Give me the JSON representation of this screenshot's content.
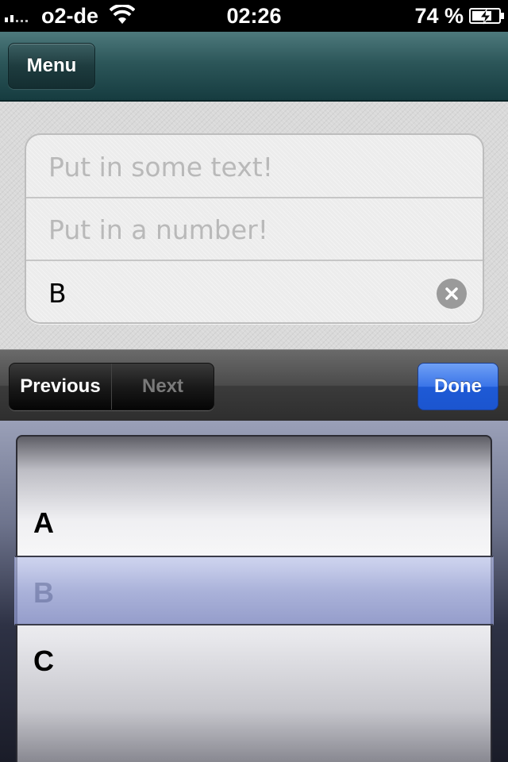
{
  "status_bar": {
    "carrier": "o2-de",
    "time": "02:26",
    "battery": "74 %",
    "battery_level": 0.74
  },
  "nav_bar": {
    "menu_label": "Menu"
  },
  "form": {
    "text_field": {
      "placeholder": "Put in some text!",
      "value": ""
    },
    "number_field": {
      "placeholder": "Put in a number!",
      "value": ""
    },
    "picker_field": {
      "value": "B"
    }
  },
  "toolbar": {
    "previous_label": "Previous",
    "next_label": "Next",
    "done_label": "Done"
  },
  "picker": {
    "options": [
      "A",
      "B",
      "C"
    ],
    "selected": "B"
  },
  "colors": {
    "nav_bar": "#2c5659",
    "done_button": "#2a66e0",
    "picker_selection": "#a3aad6"
  }
}
